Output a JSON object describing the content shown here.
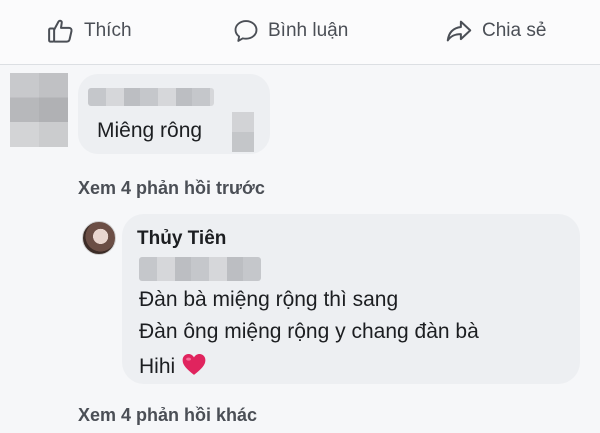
{
  "actions": {
    "like_label": "Thích",
    "comment_label": "Bình luận",
    "share_label": "Chia sẻ"
  },
  "comment": {
    "text": "Miêng rông"
  },
  "links": {
    "previous_replies": "Xem 4 phản hồi trước",
    "more_replies": "Xem 4 phản hồi khác"
  },
  "reply": {
    "author": "Thủy Tiên",
    "lines": [
      "Đàn bà miệng rộng thì sang",
      "Đàn ông miệng rộng y chang đàn bà",
      "Hihi"
    ],
    "emoji": "heart-icon"
  },
  "colors": {
    "heart": "#e0245e",
    "link_text": "#4b4f56",
    "bubble_bg": "#edeff2"
  }
}
